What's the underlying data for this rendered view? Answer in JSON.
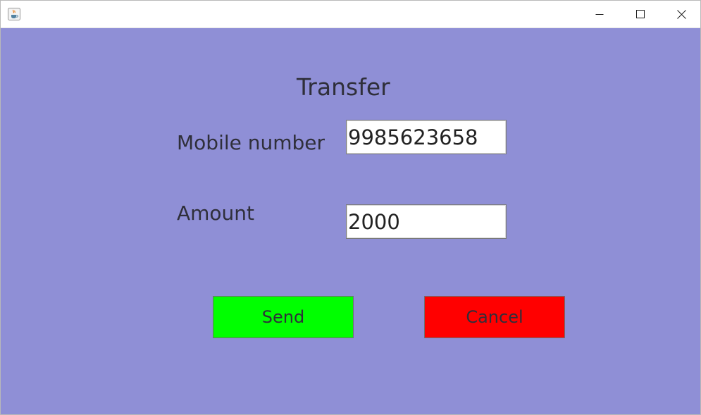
{
  "window": {
    "title": "",
    "icon": "java-cup-icon",
    "controls": {
      "minimize": "minimize-icon",
      "maximize": "maximize-icon",
      "close": "close-icon"
    }
  },
  "form": {
    "title": "Transfer",
    "mobile_label": "Mobile number",
    "mobile_value": "9985623658",
    "amount_label": "Amount",
    "amount_value": "2000"
  },
  "buttons": {
    "send_label": "Send",
    "cancel_label": "Cancel"
  },
  "colors": {
    "background": "#8f8fd6",
    "send": "#00ff00",
    "cancel": "#ff0000"
  }
}
